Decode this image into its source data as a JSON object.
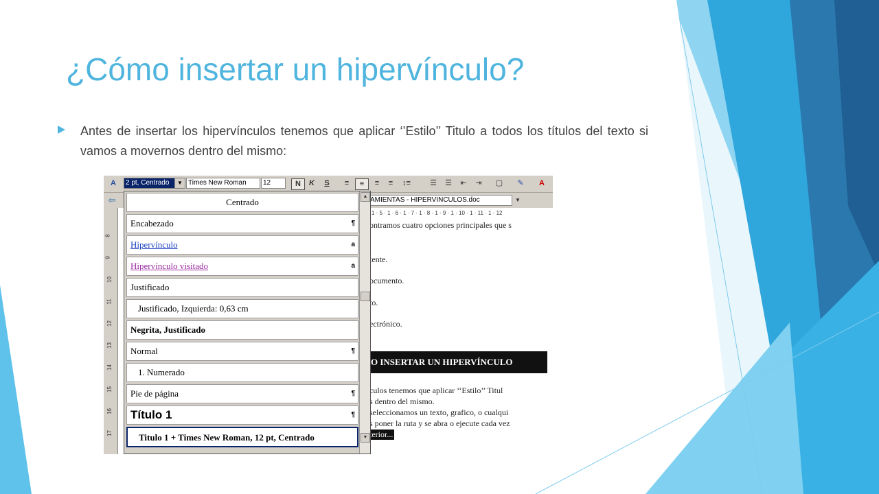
{
  "slide": {
    "title": "¿Cómo insertar un hipervínculo?",
    "bullet": "Antes de insertar los hipervínculos tenemos que aplicar ‘’Estilo’’ Titulo a todos los títulos del texto si vamos a movernos dentro del mismo:"
  },
  "colors": {
    "title": "#4fb5de",
    "bullet_arrow": "#4fb5de",
    "body_text": "#404040"
  },
  "screenshot": {
    "toolbar": {
      "style_value": "2 pt, Centrado",
      "font_value": "Times New Roman",
      "size_value": "12",
      "bold_label": "N",
      "italic_label": "K",
      "strike_label": "S"
    },
    "doc_title": "AMIENTAS - HIPERVINCULOS.doc",
    "ruler": "· 1 · 5 · 1 · 6 · 1 · 7 · 1 · 8 · 1 · 9 · 1 · 10 · 1 · 11 · 1 · 12",
    "vruler_marks": [
      "8",
      "9",
      "10",
      "11",
      "12",
      "13",
      "14",
      "15",
      "16",
      "17"
    ],
    "style_list": [
      {
        "label": "Centrado",
        "mark": ""
      },
      {
        "label": "Encabezado",
        "mark": "¶"
      },
      {
        "label": "Hipervínculo",
        "mark": "a"
      },
      {
        "label": "Hipervínculo visitado",
        "mark": "a"
      },
      {
        "label": "Justificado",
        "mark": ""
      },
      {
        "label": "Justificado, Izquierda:  0,63 cm",
        "mark": ""
      },
      {
        "label": "Negrita, Justificado",
        "mark": ""
      },
      {
        "label": "Normal",
        "mark": "¶"
      },
      {
        "label": "1.  Numerado",
        "mark": ""
      },
      {
        "label": "Pie de página",
        "mark": "¶"
      },
      {
        "label": "Título 1",
        "mark": "¶"
      },
      {
        "label": "Titulo 1 + Times New Roman, 12 pt, Centrado",
        "mark": ""
      }
    ],
    "doc_lines": [
      "ontramos cuatro opciones principales que s",
      "tente.",
      "ocumento.",
      "to.",
      "ectrónico."
    ],
    "doc_heading": "O INSERTAR UN HIPERVÍNCULO",
    "doc_after": [
      "culos tenemos que aplicar ‘‘Estilo’’ Titul",
      "s dentro del mismo.",
      "seleccionamos un texto, grafico, o cualqui",
      "s poner la ruta y se abra o ejecute cada vez",
      "terior..."
    ]
  }
}
